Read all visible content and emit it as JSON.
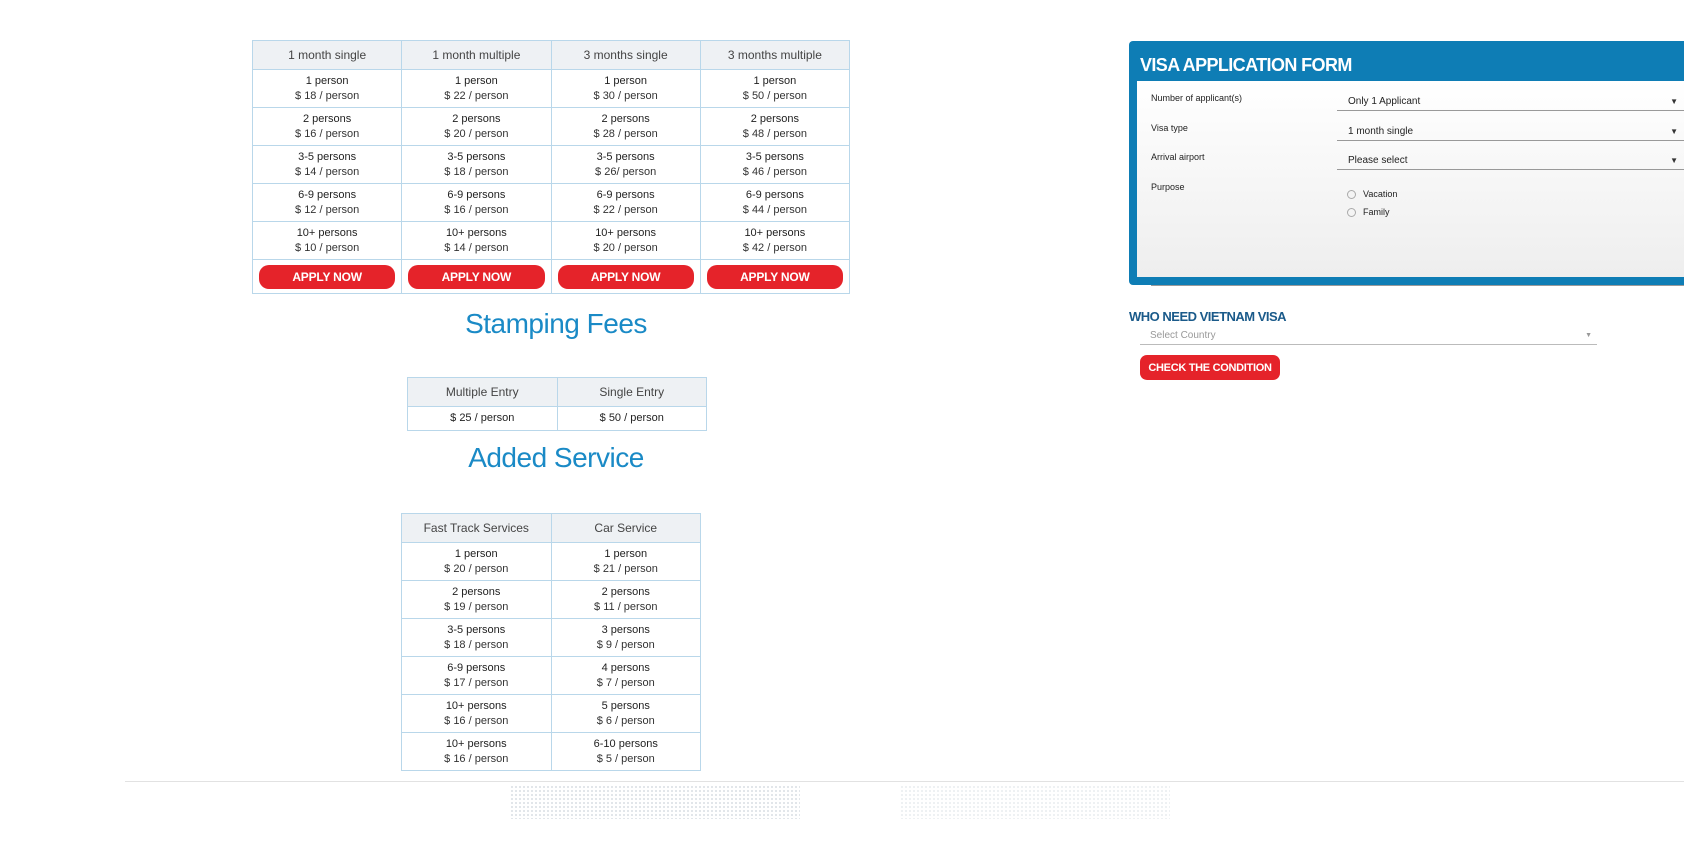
{
  "visa_fees": {
    "headers": [
      "1 month single",
      "1 month multiple",
      "3 months single",
      "3 months multiple"
    ],
    "rows": [
      [
        [
          "1 person",
          "$ 18 / person"
        ],
        [
          "1 person",
          "$ 22 / person"
        ],
        [
          "1 person",
          "$ 30 / person"
        ],
        [
          "1 person",
          "$ 50 / person"
        ]
      ],
      [
        [
          "2 persons",
          "$ 16 / person"
        ],
        [
          "2 persons",
          "$ 20 / person"
        ],
        [
          "2 persons",
          "$ 28 / person"
        ],
        [
          "2 persons",
          "$ 48 / person"
        ]
      ],
      [
        [
          "3-5 persons",
          "$ 14 / person"
        ],
        [
          "3-5 persons",
          "$ 18 / person"
        ],
        [
          "3-5 persons",
          "$ 26/ person"
        ],
        [
          "3-5 persons",
          "$ 46 / person"
        ]
      ],
      [
        [
          "6-9 persons",
          "$ 12 / person"
        ],
        [
          "6-9 persons",
          "$ 16 / person"
        ],
        [
          "6-9 persons",
          "$ 22 / person"
        ],
        [
          "6-9 persons",
          "$ 44 / person"
        ]
      ],
      [
        [
          "10+ persons",
          "$ 10 / person"
        ],
        [
          "10+ persons",
          "$ 14 / person"
        ],
        [
          "10+ persons",
          "$ 20 / person"
        ],
        [
          "10+ persons",
          "$ 42 / person"
        ]
      ]
    ],
    "apply_label": "APPLY NOW"
  },
  "stamping": {
    "title": "Stamping Fees",
    "headers": [
      "Multiple Entry",
      "Single Entry"
    ],
    "values": [
      "$ 25 / person",
      "$ 50 / person"
    ]
  },
  "added_service": {
    "title": "Added Service",
    "headers": [
      "Fast Track Services",
      "Car Service"
    ],
    "rows": [
      [
        [
          "1 person",
          "$ 20 / person"
        ],
        [
          "1 person",
          "$ 21 / person"
        ]
      ],
      [
        [
          "2 persons",
          "$ 19 / person"
        ],
        [
          "2 persons",
          "$ 11 / person"
        ]
      ],
      [
        [
          "3-5 persons",
          "$ 18 / person"
        ],
        [
          "3 persons",
          "$ 9 / person"
        ]
      ],
      [
        [
          "6-9 persons",
          "$ 17 / person"
        ],
        [
          "4 persons",
          "$ 7 / person"
        ]
      ],
      [
        [
          "10+ persons",
          "$ 16 / person"
        ],
        [
          "5 persons",
          "$ 6 / person"
        ]
      ],
      [
        [
          "10+ persons",
          "$ 16 / person"
        ],
        [
          "6-10 persons",
          "$ 5 / person"
        ]
      ]
    ]
  },
  "visa_form": {
    "title": "VISA APPLICATION FORM",
    "applicants_label": "Number of applicant(s)",
    "applicants_value": "Only 1 Applicant",
    "visa_type_label": "Visa type",
    "visa_type_value": "1 month single",
    "airport_label": "Arrival airport",
    "airport_value": "Please select",
    "purpose_label": "Purpose",
    "purpose_options": [
      "Vacation",
      "Family"
    ],
    "caret": "▼"
  },
  "who_need": {
    "title": "WHO NEED VIETNAM VISA",
    "placeholder": "Select Country",
    "caret": "▼",
    "button_label": "CHECK THE CONDITION"
  },
  "colors": {
    "accent_blue": "#0e7db5",
    "title_blue": "#1a8ac6",
    "button_red": "#e5232a",
    "table_border": "#b9d7ea",
    "header_bg": "#eef1f4"
  }
}
